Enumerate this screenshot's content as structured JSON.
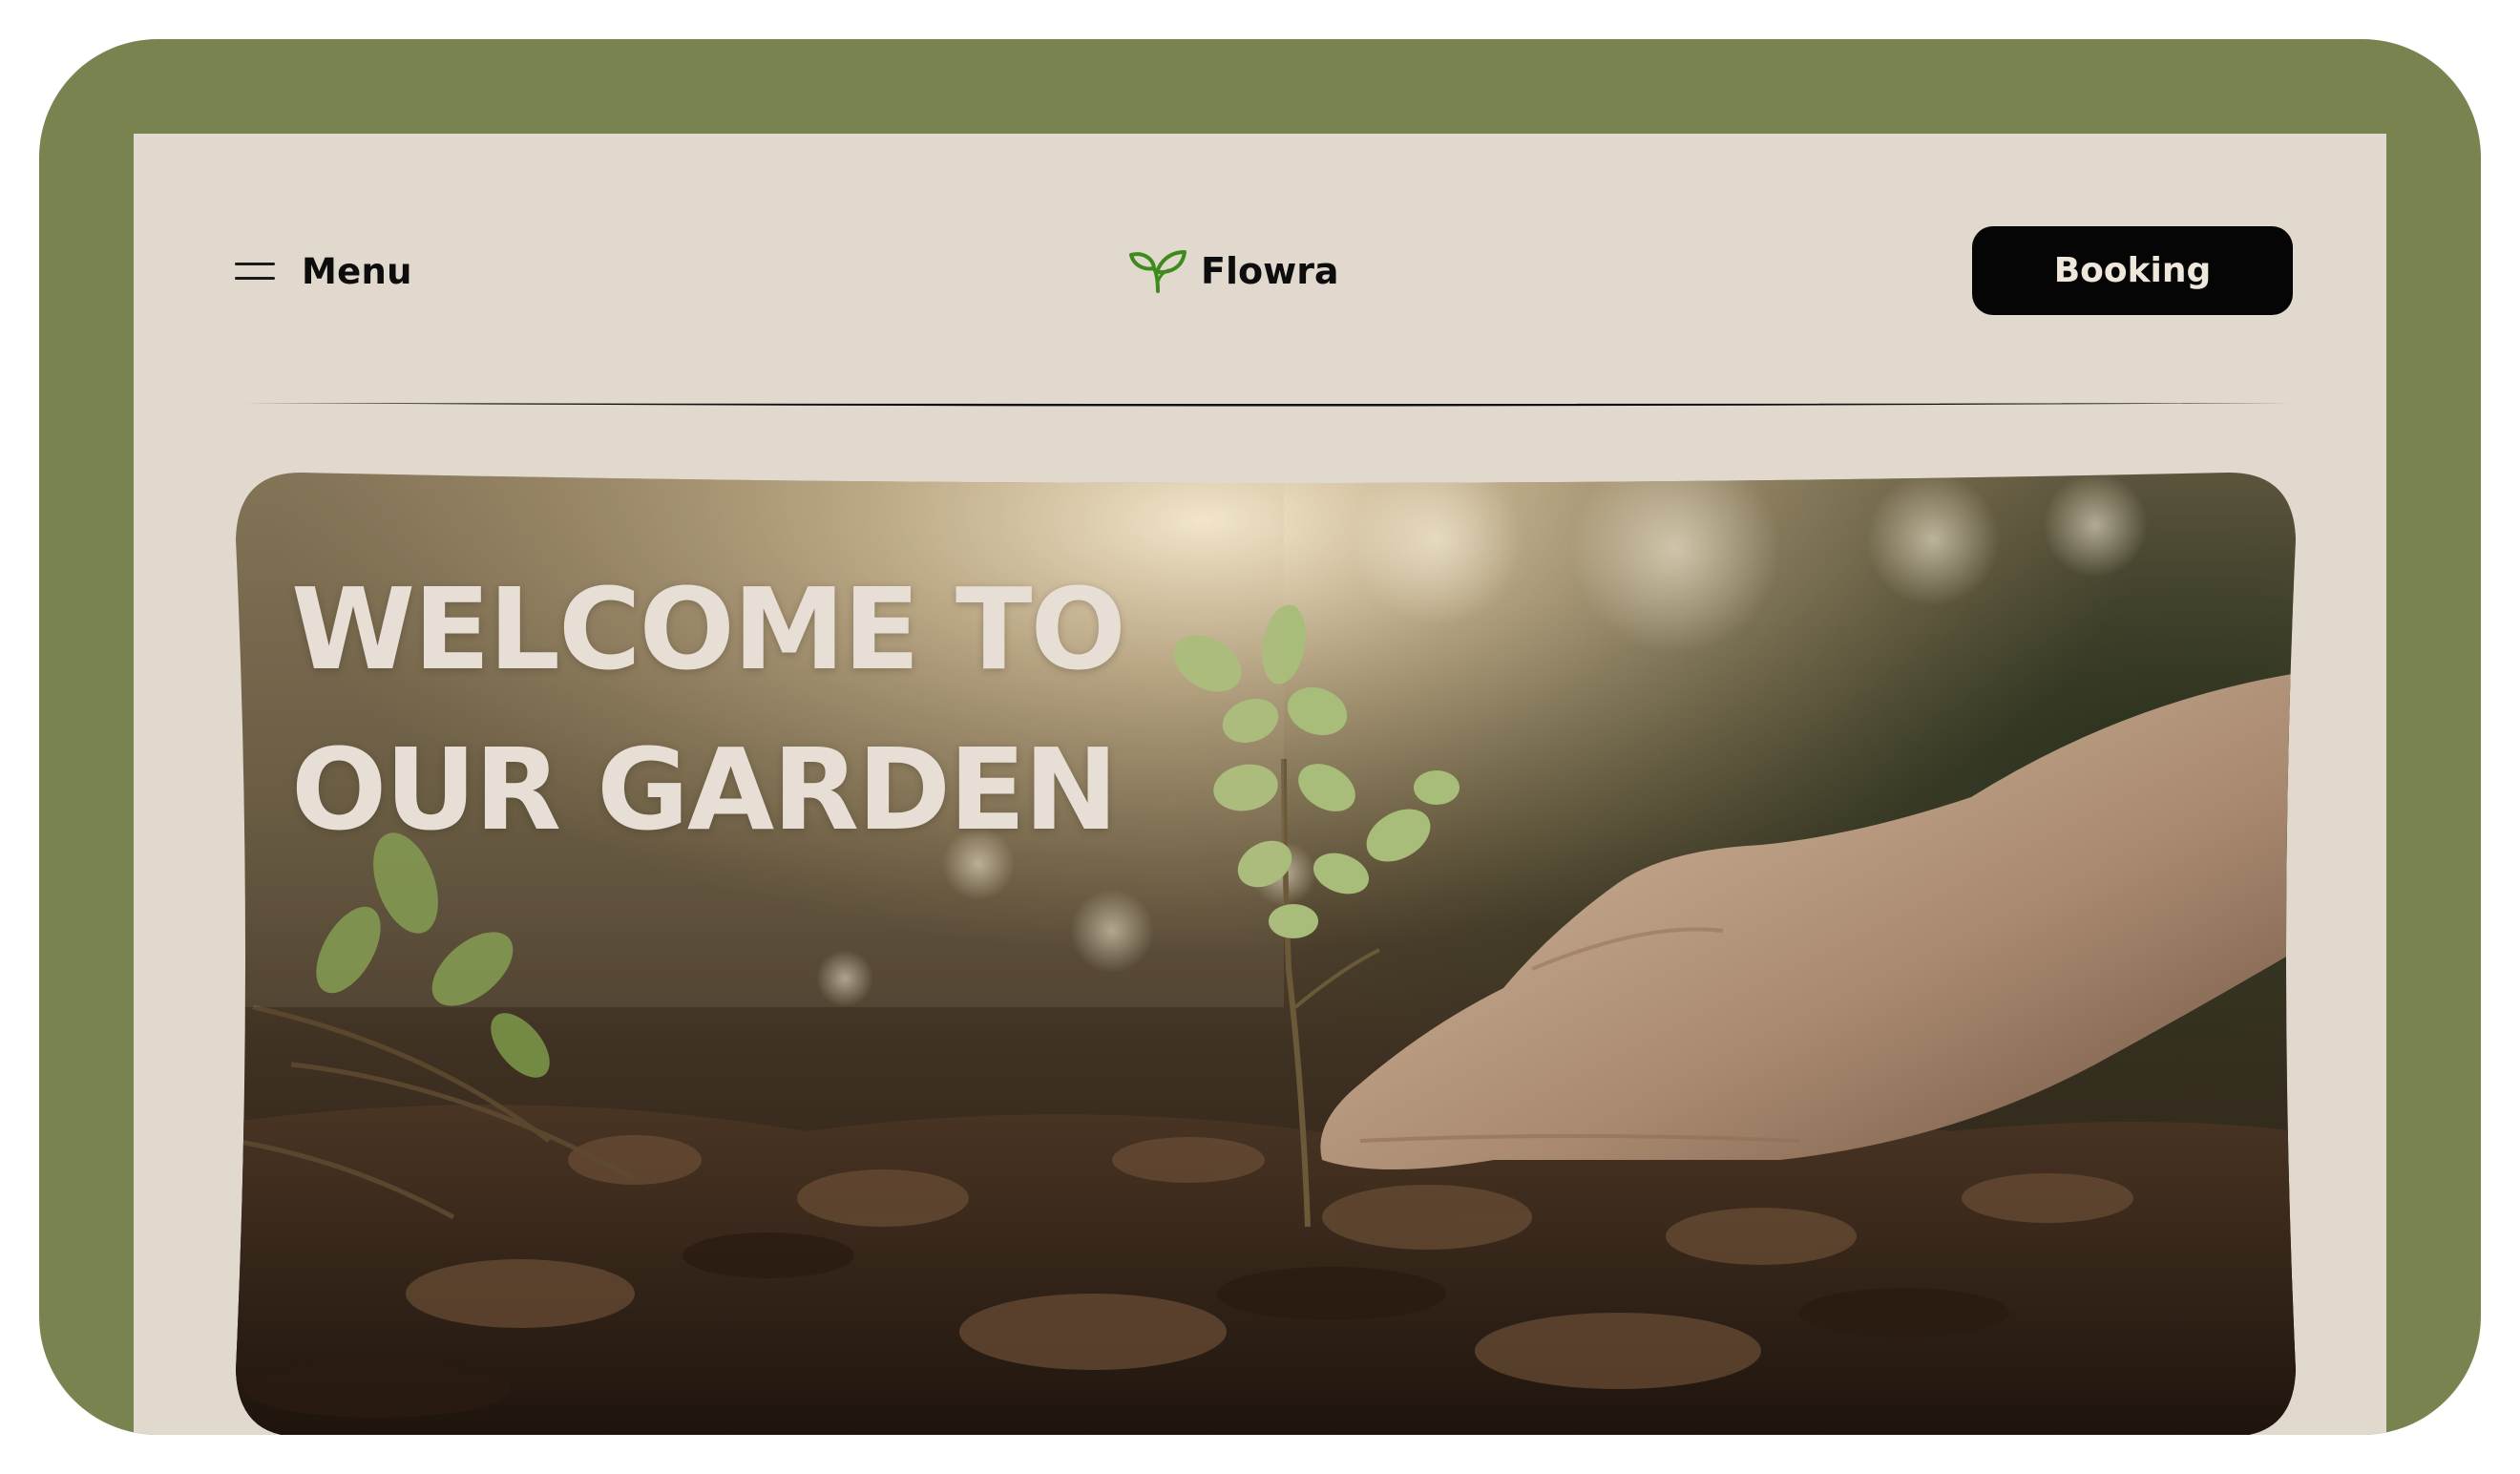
{
  "header": {
    "menu_label": "Menu",
    "menu_icon": "hamburger-icon",
    "logo_label": "Flowra",
    "logo_icon": "sprout-icon",
    "booking_label": "Booking"
  },
  "hero": {
    "title_line1": "WELCOME TO",
    "title_line2": "OUR GARDEN",
    "image": "hand-planting-seedling-photo"
  },
  "colors": {
    "frame": "#78834f",
    "page": "#e2d9ce",
    "button": "#050505",
    "logo_green": "#3f8a1c",
    "hero_text": "#e7ded5"
  }
}
